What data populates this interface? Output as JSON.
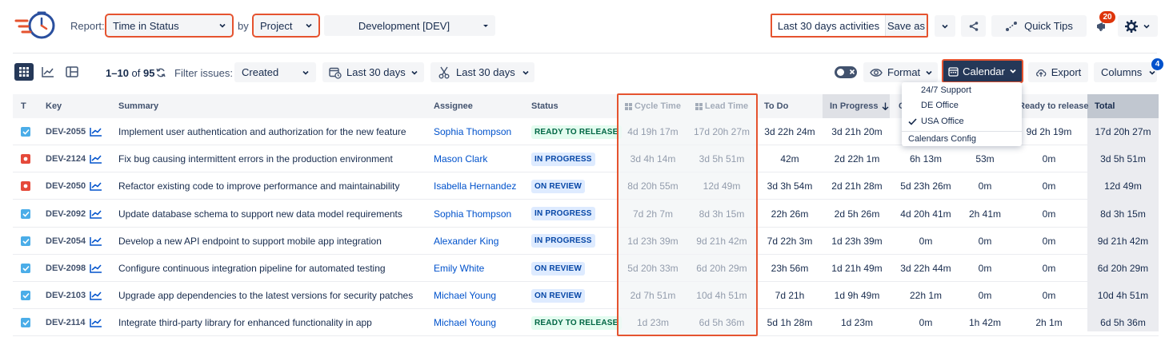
{
  "header": {
    "report_label": "Report:",
    "report_value": "Time in Status",
    "by_label": "by",
    "group_value": "Project",
    "project_value": "Development [DEV]",
    "activities_label": "Last 30 days activities",
    "save_as_label": "Save as",
    "quick_tips_label": "Quick Tips",
    "notification_count": "20"
  },
  "filterbar": {
    "range_text": "1–10",
    "of_text": "of",
    "total_text": "95",
    "filter_label": "Filter issues:",
    "filter_field": "Created",
    "date_range_1": "Last 30 days",
    "date_range_2": "Last 30 days",
    "format_label": "Format",
    "calendar_label": "Calendar",
    "export_label": "Export",
    "columns_label": "Columns",
    "columns_badge": "4"
  },
  "calendar_menu": {
    "items": [
      "24/7 Support",
      "DE Office",
      "USA Office"
    ],
    "selected": "USA Office",
    "config_label": "Calendars Config"
  },
  "table": {
    "headers": {
      "type": "T",
      "key": "Key",
      "summary": "Summary",
      "assignee": "Assignee",
      "status": "Status",
      "cycle_time": "Cycle Time",
      "lead_time": "Lead Time",
      "to_do": "To Do",
      "in_progress": "In Progress",
      "col_hidden": "C",
      "ready_to_release": "Ready to release",
      "total": "Total"
    },
    "rows": [
      {
        "type": "task",
        "key": "DEV-2055",
        "summary": "Implement user authentication and authorization for the new feature",
        "assignee": "Sophia Thompson",
        "status": "READY TO RELEASE",
        "status_kind": "ready",
        "cycle": "4d 19h 17m",
        "lead": "17d 20h 27m",
        "todo": "3d 22h 24m",
        "inprog": "3d 21h 20m",
        "c1": "",
        "c2": "",
        "ready": "9d 2h 19m",
        "total": "17d 20h 27m"
      },
      {
        "type": "bug",
        "key": "DEV-2124",
        "summary": "Fix bug causing intermittent errors in the production environment",
        "assignee": "Mason Clark",
        "status": "IN PROGRESS",
        "status_kind": "prog",
        "cycle": "3d 4h 14m",
        "lead": "3d 5h 51m",
        "todo": "42m",
        "inprog": "2d 22h 1m",
        "c1": "6h 13m",
        "c2": "53m",
        "ready": "0m",
        "total": "3d 5h 51m"
      },
      {
        "type": "bug",
        "key": "DEV-2050",
        "summary": "Refactor existing code to improve performance and maintainability",
        "assignee": "Isabella Hernandez",
        "status": "ON REVIEW",
        "status_kind": "rev",
        "cycle": "8d 20h 55m",
        "lead": "12d 49m",
        "todo": "3d 3h 54m",
        "inprog": "2d 21h 28m",
        "c1": "5d 23h 26m",
        "c2": "0m",
        "ready": "0m",
        "total": "12d 49m"
      },
      {
        "type": "task",
        "key": "DEV-2092",
        "summary": "Update database schema to support new data model requirements",
        "assignee": "Sophia Thompson",
        "status": "IN PROGRESS",
        "status_kind": "prog",
        "cycle": "7d 2h 7m",
        "lead": "8d 3h 15m",
        "todo": "22h 26m",
        "inprog": "2d 5h 26m",
        "c1": "4d 20h 41m",
        "c2": "2h 41m",
        "ready": "0m",
        "total": "8d 3h 15m"
      },
      {
        "type": "task",
        "key": "DEV-2054",
        "summary": "Develop a new API endpoint to support mobile app integration",
        "assignee": "Alexander King",
        "status": "IN PROGRESS",
        "status_kind": "prog",
        "cycle": "1d 23h 39m",
        "lead": "9d 21h 42m",
        "todo": "7d 22h 3m",
        "inprog": "1d 23h 39m",
        "c1": "0m",
        "c2": "0m",
        "ready": "0m",
        "total": "9d 21h 42m"
      },
      {
        "type": "task",
        "key": "DEV-2098",
        "summary": "Configure continuous integration pipeline for automated testing",
        "assignee": "Emily White",
        "status": "ON REVIEW",
        "status_kind": "rev",
        "cycle": "5d 20h 33m",
        "lead": "6d 20h 29m",
        "todo": "23h 56m",
        "inprog": "1d 21h 49m",
        "c1": "3d 22h 44m",
        "c2": "0m",
        "ready": "0m",
        "total": "6d 20h 29m"
      },
      {
        "type": "task",
        "key": "DEV-2103",
        "summary": "Upgrade app dependencies to the latest versions for security patches",
        "assignee": "Michael Young",
        "status": "ON REVIEW",
        "status_kind": "rev",
        "cycle": "2d 7h 51m",
        "lead": "10d 4h 51m",
        "todo": "7d 21h",
        "inprog": "1d 9h 49m",
        "c1": "22h 1m",
        "c2": "0m",
        "ready": "0m",
        "total": "10d 4h 51m"
      },
      {
        "type": "task",
        "key": "DEV-2114",
        "summary": "Integrate third-party library for enhanced functionality in app",
        "assignee": "Michael Young",
        "status": "READY TO RELEASE",
        "status_kind": "ready",
        "cycle": "1d 23m",
        "lead": "6d 5h 36m",
        "todo": "5d 1h 28m",
        "inprog": "1d 23m",
        "c1": "0m",
        "c2": "1h 42m",
        "ready": "2h 1m",
        "total": "6d 5h 36m"
      }
    ]
  }
}
